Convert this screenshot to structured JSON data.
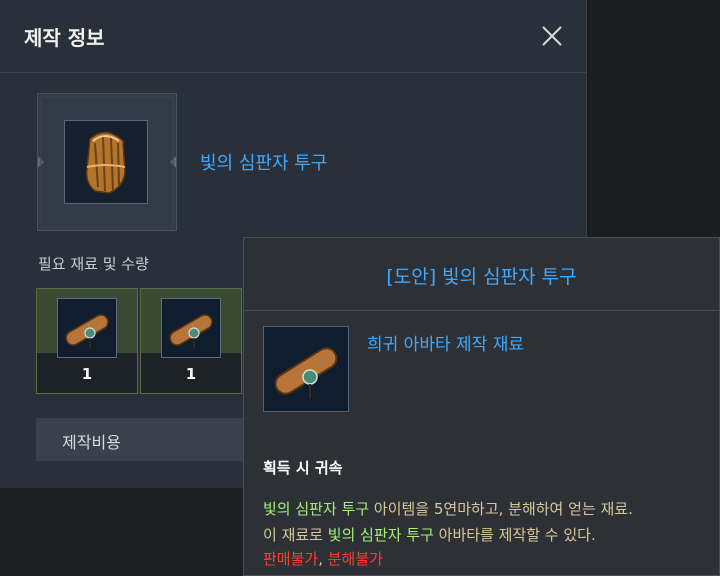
{
  "window": {
    "title": "제작 정보"
  },
  "item": {
    "name": "빛의 심판자 투구",
    "icon": "helmet-icon"
  },
  "materials": {
    "label": "필요 재료 및 수량",
    "slots": [
      {
        "icon": "scroll-icon",
        "count": "1"
      },
      {
        "icon": "scroll-icon",
        "count": "1"
      }
    ]
  },
  "cost": {
    "label": "제작비용"
  },
  "tooltip": {
    "title": "[도안] 빛의 심판자 투구",
    "icon": "scroll-icon",
    "category": "희귀 아바타 제작 재료",
    "bind": "획득 시 귀속",
    "desc": {
      "line1_hl": "빛의 심판자 투구",
      "line1_rest": " 아이템을 5연마하고, 분해하여 얻는 재료.",
      "line2_pre": "이 재료로 ",
      "line2_hl": "빛의 심판자 투구",
      "line2_rest": " 아바타를 제작할 수 있다."
    },
    "trade": {
      "no_sell": "판매불가",
      "sep": ", ",
      "no_disassemble": "분해불가"
    }
  },
  "colors": {
    "accent_blue": "#3fa9ff",
    "highlight_green": "#a6f07a",
    "warning_red": "#ff3b30",
    "desc_gold": "#d7c79a"
  }
}
